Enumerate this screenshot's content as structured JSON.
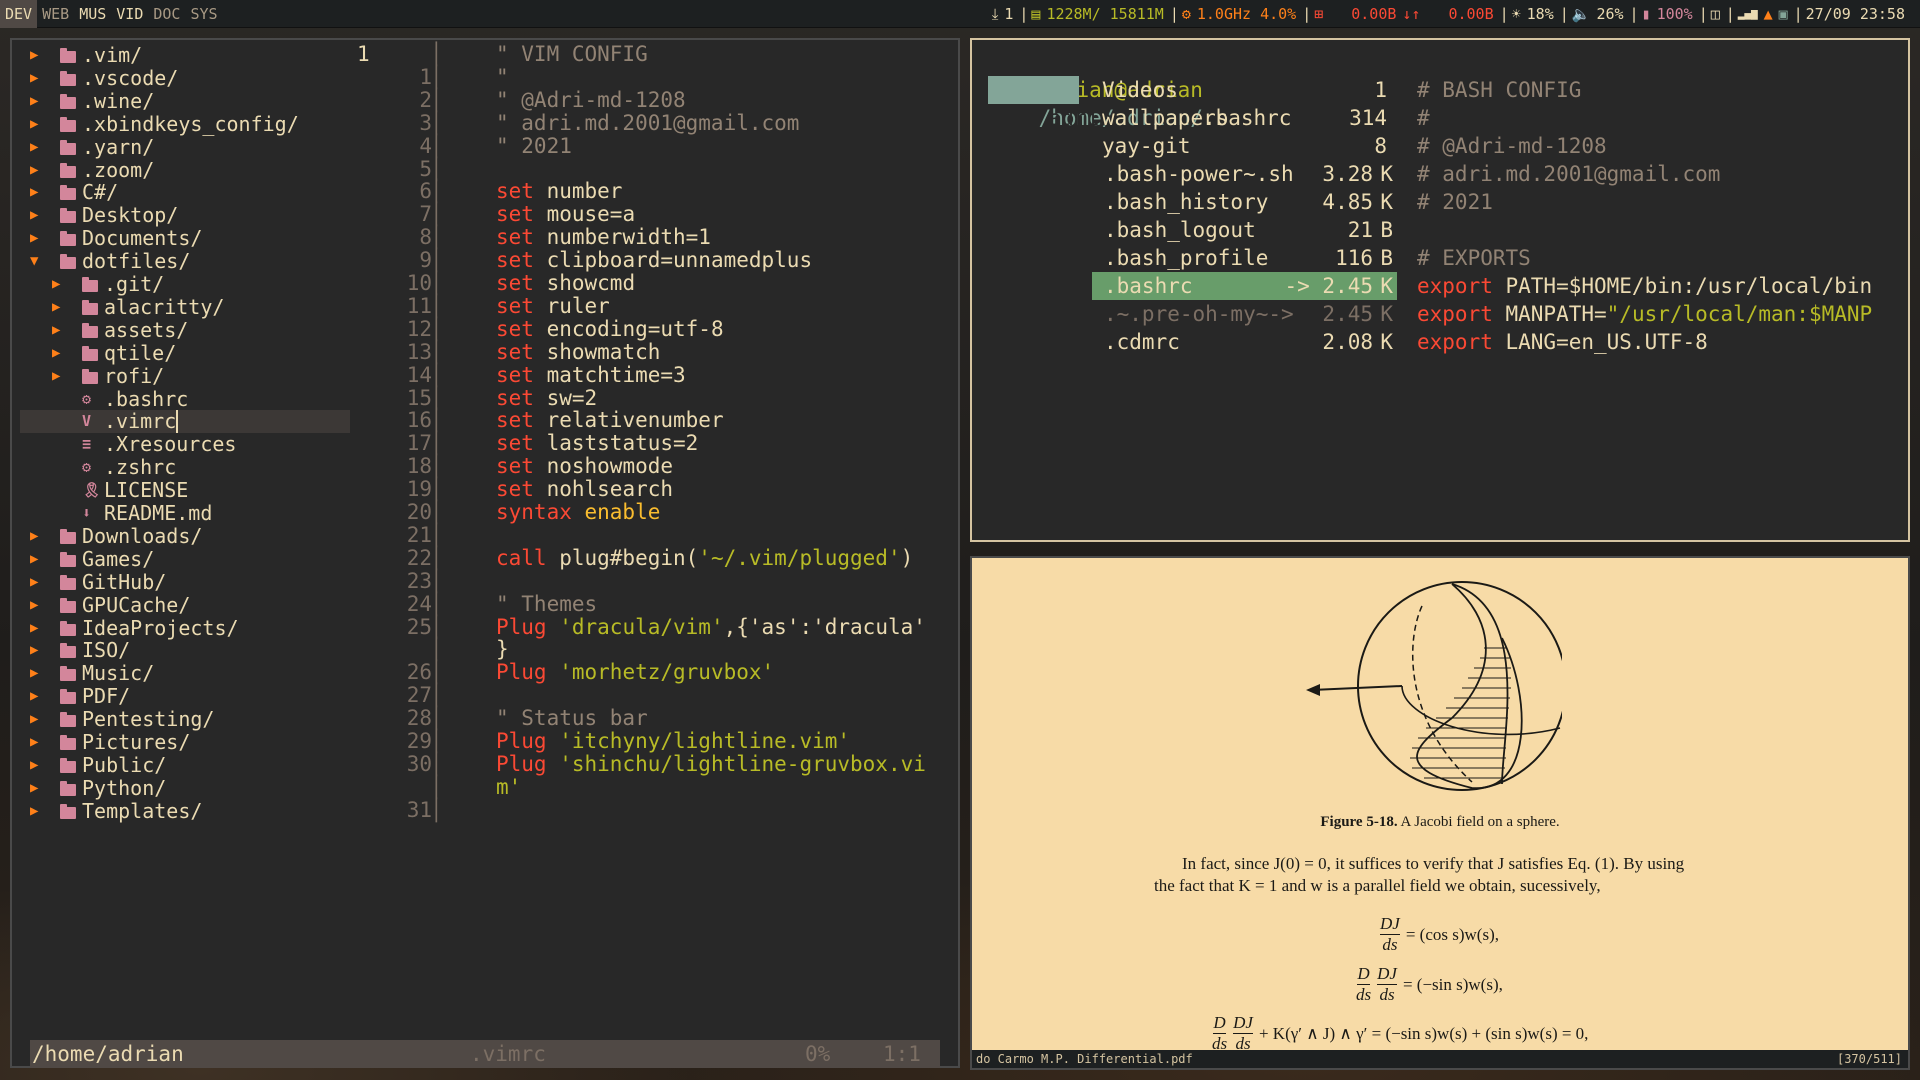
{
  "topbar": {
    "workspaces": [
      {
        "label": "DEV",
        "state": "active"
      },
      {
        "label": "WEB",
        "state": "empty"
      },
      {
        "label": "MUS",
        "state": "occupied"
      },
      {
        "label": "VID",
        "state": "occupied"
      },
      {
        "label": "DOC",
        "state": "empty"
      },
      {
        "label": "SYS",
        "state": "empty"
      }
    ],
    "updates": "1",
    "memory": "1228M/ 15811M",
    "cpu": "1.0GHz 4.0%",
    "net_down": "0.00B",
    "net_arrows": "↓↑",
    "net_up": "0.00B",
    "brightness": "18%",
    "volume": "26%",
    "battery": "100%",
    "datetime": "27/09 23:58",
    "colors": {
      "memory": "#b8bb26",
      "cpu": "#fe8019",
      "net": "#fb4934",
      "brightness": "#ebdbb2",
      "volume": "#ebdbb2",
      "battery": "#d3869b"
    }
  },
  "vim": {
    "tree": [
      {
        "indent": 0,
        "kind": "dir",
        "open": false,
        "name": ".vim/"
      },
      {
        "indent": 0,
        "kind": "dir",
        "open": false,
        "name": ".vscode/"
      },
      {
        "indent": 0,
        "kind": "dir",
        "open": false,
        "name": ".wine/"
      },
      {
        "indent": 0,
        "kind": "dir",
        "open": false,
        "name": ".xbindkeys_config/"
      },
      {
        "indent": 0,
        "kind": "dir",
        "open": false,
        "name": ".yarn/"
      },
      {
        "indent": 0,
        "kind": "dir",
        "open": false,
        "name": ".zoom/"
      },
      {
        "indent": 0,
        "kind": "dir",
        "open": false,
        "name": "C#/"
      },
      {
        "indent": 0,
        "kind": "dir",
        "open": false,
        "name": "Desktop/"
      },
      {
        "indent": 0,
        "kind": "dir",
        "open": false,
        "name": "Documents/"
      },
      {
        "indent": 0,
        "kind": "dir",
        "open": true,
        "name": "dotfiles/"
      },
      {
        "indent": 1,
        "kind": "dir",
        "open": false,
        "name": ".git/"
      },
      {
        "indent": 1,
        "kind": "dir",
        "open": false,
        "name": "alacritty/"
      },
      {
        "indent": 1,
        "kind": "dir",
        "open": false,
        "name": "assets/"
      },
      {
        "indent": 1,
        "kind": "dir",
        "open": false,
        "name": "qtile/"
      },
      {
        "indent": 1,
        "kind": "dir",
        "open": false,
        "name": "rofi/"
      },
      {
        "indent": 1,
        "kind": "file",
        "icon": "gear",
        "name": ".bashrc"
      },
      {
        "indent": 1,
        "kind": "file",
        "icon": "vim",
        "name": ".vimrc",
        "selected": true
      },
      {
        "indent": 1,
        "kind": "file",
        "icon": "lines",
        "name": ".Xresources"
      },
      {
        "indent": 1,
        "kind": "file",
        "icon": "gear",
        "name": ".zshrc"
      },
      {
        "indent": 1,
        "kind": "file",
        "icon": "ribbon",
        "name": "LICENSE"
      },
      {
        "indent": 1,
        "kind": "file",
        "icon": "download",
        "name": "README.md"
      },
      {
        "indent": 0,
        "kind": "dir",
        "open": false,
        "name": "Downloads/"
      },
      {
        "indent": 0,
        "kind": "dir",
        "open": false,
        "name": "Games/"
      },
      {
        "indent": 0,
        "kind": "dir",
        "open": false,
        "name": "GitHub/"
      },
      {
        "indent": 0,
        "kind": "dir",
        "open": false,
        "name": "GPUCache/"
      },
      {
        "indent": 0,
        "kind": "dir",
        "open": false,
        "name": "IdeaProjects/"
      },
      {
        "indent": 0,
        "kind": "dir",
        "open": false,
        "name": "ISO/"
      },
      {
        "indent": 0,
        "kind": "dir",
        "open": false,
        "name": "Music/"
      },
      {
        "indent": 0,
        "kind": "dir",
        "open": false,
        "name": "PDF/"
      },
      {
        "indent": 0,
        "kind": "dir",
        "open": false,
        "name": "Pentesting/"
      },
      {
        "indent": 0,
        "kind": "dir",
        "open": false,
        "name": "Pictures/"
      },
      {
        "indent": 0,
        "kind": "dir",
        "open": false,
        "name": "Public/"
      },
      {
        "indent": 0,
        "kind": "dir",
        "open": false,
        "name": "Python/"
      },
      {
        "indent": 0,
        "kind": "dir",
        "open": false,
        "name": "Templates/"
      }
    ],
    "lines": [
      {
        "n": "1",
        "text": "\" VIM CONFIG",
        "type": "comment",
        "current": true
      },
      {
        "n": "1",
        "text": "\"",
        "type": "comment"
      },
      {
        "n": "2",
        "text": "\" @Adri-md-1208",
        "type": "comment"
      },
      {
        "n": "3",
        "text": "\" adri.md.2001@gmail.com",
        "type": "comment"
      },
      {
        "n": "4",
        "text": "\" 2021",
        "type": "comment"
      },
      {
        "n": "5",
        "text": "",
        "type": "plain"
      },
      {
        "n": "6",
        "kw": "set",
        "rest": " number",
        "type": "set"
      },
      {
        "n": "7",
        "kw": "set",
        "rest": " mouse=a",
        "type": "set"
      },
      {
        "n": "8",
        "kw": "set",
        "rest": " numberwidth=1",
        "type": "set"
      },
      {
        "n": "9",
        "kw": "set",
        "rest": " clipboard=unnamedplus",
        "type": "set"
      },
      {
        "n": "10",
        "kw": "set",
        "rest": " showcmd",
        "type": "set"
      },
      {
        "n": "11",
        "kw": "set",
        "rest": " ruler",
        "type": "set"
      },
      {
        "n": "12",
        "kw": "set",
        "rest": " encoding=utf-8",
        "type": "set"
      },
      {
        "n": "13",
        "kw": "set",
        "rest": " showmatch",
        "type": "set"
      },
      {
        "n": "14",
        "kw": "set",
        "rest": " matchtime=3",
        "type": "set"
      },
      {
        "n": "15",
        "kw": "set",
        "rest": " sw=2",
        "type": "set"
      },
      {
        "n": "16",
        "kw": "set",
        "rest": " relativenumber",
        "type": "set"
      },
      {
        "n": "17",
        "kw": "set",
        "rest": " laststatus=2",
        "type": "set"
      },
      {
        "n": "18",
        "kw": "set",
        "rest": " noshowmode",
        "type": "set"
      },
      {
        "n": "19",
        "kw": "set",
        "rest": " nohlsearch",
        "type": "set"
      },
      {
        "n": "20",
        "kw": "syntax",
        "rest": " enable",
        "type": "syntax"
      },
      {
        "n": "21",
        "text": "",
        "type": "plain"
      },
      {
        "n": "22",
        "kw": "call",
        "rest": " plug#begin(",
        "str": "'~/.vim/plugged'",
        "tail": ")",
        "type": "call"
      },
      {
        "n": "23",
        "text": "",
        "type": "plain"
      },
      {
        "n": "24",
        "text": "\" Themes",
        "type": "comment"
      },
      {
        "n": "25",
        "kw": "Plug",
        "rest": " ",
        "str": "'dracula/vim'",
        "tail": ",{'as':'dracula'",
        "type": "plug"
      },
      {
        "n": "",
        "text": "}",
        "type": "plain"
      },
      {
        "n": "26",
        "kw": "Plug",
        "rest": " ",
        "str": "'morhetz/gruvbox'",
        "tail": "",
        "type": "plug"
      },
      {
        "n": "27",
        "text": "",
        "type": "plain"
      },
      {
        "n": "28",
        "text": "\" Status bar",
        "type": "comment"
      },
      {
        "n": "29",
        "kw": "Plug",
        "rest": " ",
        "str": "'itchyny/lightline.vim'",
        "tail": "",
        "type": "plug"
      },
      {
        "n": "30",
        "kw": "Plug",
        "rest": " ",
        "str": "'shinchu/lightline-gruvbox.vi",
        "tail": "",
        "type": "plug"
      },
      {
        "n": "",
        "text": "m'",
        "type": "string"
      },
      {
        "n": "31",
        "text": "",
        "type": "plain"
      }
    ],
    "status": {
      "path": "/home/adrian",
      "file": ".vimrc",
      "percent": "0%",
      "position": "1:1"
    }
  },
  "bash": {
    "prompt_user": "adrian@adrian",
    "prompt_dir": "/home/adrian/",
    "prompt_file": ".bashrc",
    "parent_entry": "adrian",
    "entries": [
      {
        "name": "Videos",
        "size": "1",
        "unit": ""
      },
      {
        "name": "wallpapers",
        "size": "314",
        "unit": ""
      },
      {
        "name": "yay-git",
        "size": "8",
        "unit": ""
      },
      {
        "name": ".bash-power~.sh",
        "size": "3.28",
        "unit": "K"
      },
      {
        "name": ".bash_history",
        "size": "4.85",
        "unit": "K"
      },
      {
        "name": ".bash_logout",
        "size": "21",
        "unit": "B"
      },
      {
        "name": ".bash_profile",
        "size": "116",
        "unit": "B"
      },
      {
        "name": ".bashrc",
        "size": "-> 2.45",
        "unit": "K",
        "selected": true
      },
      {
        "name": ".~.pre-oh-my~->",
        "size": "2.45",
        "unit": "K",
        "dim": true
      },
      {
        "name": ".cdmrc",
        "size": "2.08",
        "unit": "K"
      }
    ],
    "preview": [
      {
        "type": "comment",
        "text": "# BASH CONFIG"
      },
      {
        "type": "comment",
        "text": "#"
      },
      {
        "type": "comment",
        "text": "# @Adri-md-1208"
      },
      {
        "type": "comment",
        "text": "# adri.md.2001@gmail.com"
      },
      {
        "type": "comment",
        "text": "# 2021"
      },
      {
        "type": "blank",
        "text": ""
      },
      {
        "type": "comment",
        "text": "# EXPORTS"
      },
      {
        "type": "export",
        "kw": "export",
        "var": " PATH=",
        "val": "$HOME/bin:/usr/local/bin"
      },
      {
        "type": "export",
        "kw": "export",
        "var": " MANPATH=",
        "val": "\"/usr/local/man:$MANP"
      },
      {
        "type": "export",
        "kw": "export",
        "var": " LANG=",
        "val": "en_US.UTF-8"
      }
    ]
  },
  "pdf": {
    "caption_label": "Figure 5-18.",
    "caption_text": "A Jacobi field on a sphere.",
    "para_line1": "In fact, since J(0) = 0, it suffices to verify that J satisfies Eq. (1). By using",
    "para_line2": "the fact that K = 1 and w is a parallel field we obtain, sucessively,",
    "eq1_lhs_num": "DJ",
    "eq1_lhs_den": "ds",
    "eq1_rhs": "= (cos s)w(s),",
    "eq2_d": "D",
    "eq2_ds": "ds",
    "eq2_num": "DJ",
    "eq2_den": "ds",
    "eq2_rhs": "= (−sin s)w(s),",
    "eq3_d": "D",
    "eq3_ds": "ds",
    "eq3_num": "DJ",
    "eq3_den": "ds",
    "eq3_rhs": "+ K(γ′ ∧ J) ∧ γ′ = (−sin s)w(s) + (sin s)w(s) = 0,",
    "filename": "do Carmo M.P. Differential.pdf",
    "page_indicator": "[370/511]"
  }
}
